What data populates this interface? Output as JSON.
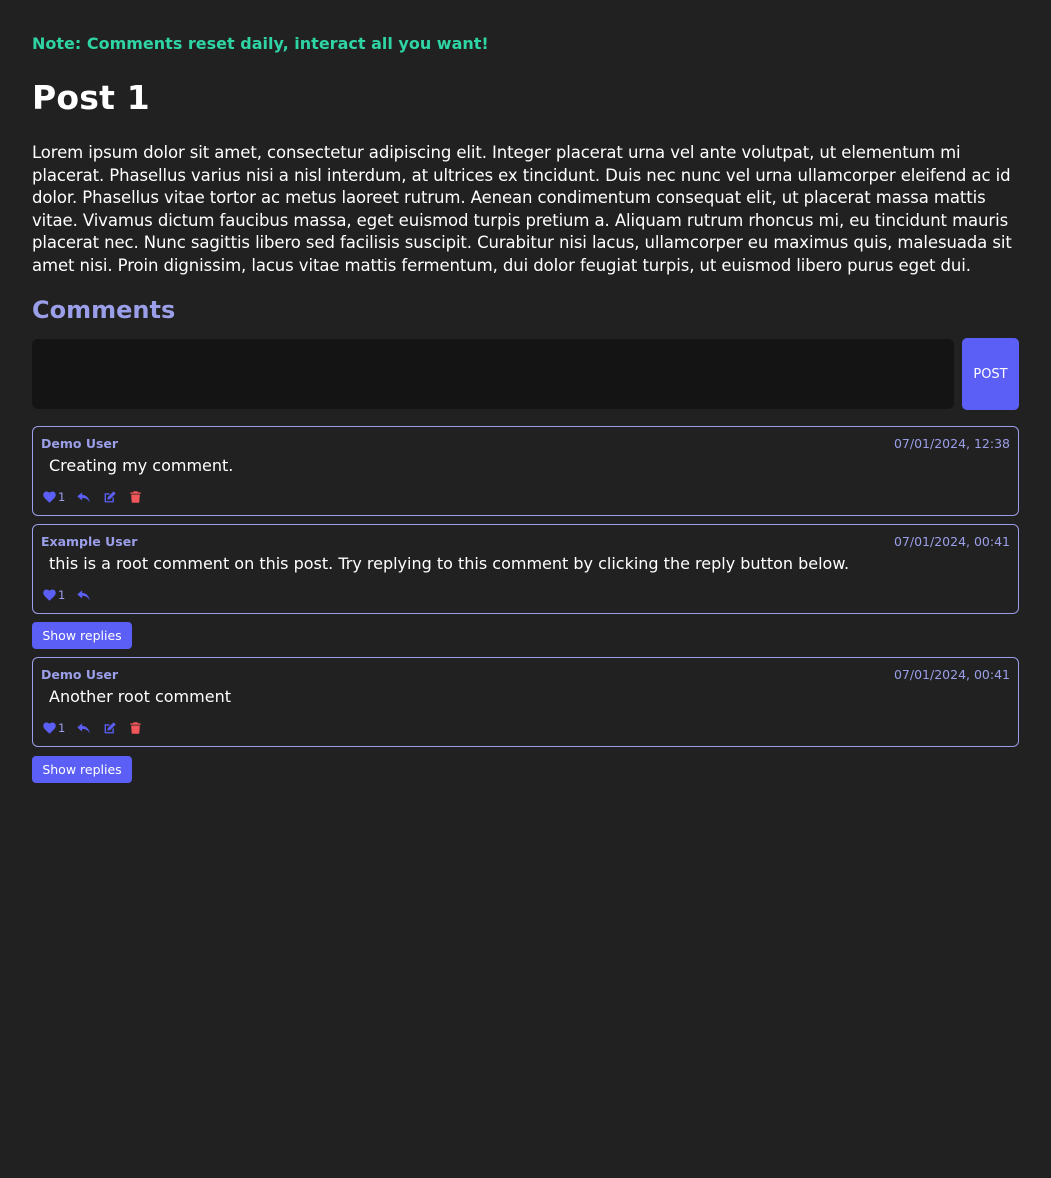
{
  "note": "Note: Comments reset daily, interact all you want!",
  "post": {
    "title": "Post 1",
    "body": "Lorem ipsum dolor sit amet, consectetur adipiscing elit. Integer placerat urna vel ante volutpat, ut elementum mi placerat. Phasellus varius nisi a nisl interdum, at ultrices ex tincidunt. Duis nec nunc vel urna ullamcorper eleifend ac id dolor. Phasellus vitae tortor ac metus laoreet rutrum. Aenean condimentum consequat elit, ut placerat massa mattis vitae. Vivamus dictum faucibus massa, eget euismod turpis pretium a. Aliquam rutrum rhoncus mi, eu tincidunt mauris placerat nec. Nunc sagittis libero sed facilisis suscipit. Curabitur nisi lacus, ullamcorper eu maximus quis, malesuada sit amet nisi. Proin dignissim, lacus vitae mattis fermentum, dui dolor feugiat turpis, ut euismod libero purus eget dui."
  },
  "comments_section": {
    "heading": "Comments",
    "input_value": "",
    "post_button_label": "POST"
  },
  "comments": [
    {
      "author": "Demo User",
      "date": "07/01/2024, 12:38",
      "text": "Creating my comment.",
      "likes": "1",
      "can_edit": true,
      "show_replies_label": null
    },
    {
      "author": "Example User",
      "date": "07/01/2024, 00:41",
      "text": "this is a root comment on this post. Try replying to this comment by clicking the reply button below.",
      "likes": "1",
      "can_edit": false,
      "show_replies_label": "Show replies"
    },
    {
      "author": "Demo User",
      "date": "07/01/2024, 00:41",
      "text": "Another root comment",
      "likes": "1",
      "can_edit": true,
      "show_replies_label": "Show replies"
    }
  ],
  "colors": {
    "background": "#212121",
    "note": "#2fd4a4",
    "accent": "#9b9ee8",
    "button": "#5b5ff5",
    "input_bg": "#141414",
    "delete": "#f0565a"
  },
  "icons": {
    "like": "heart-icon",
    "reply": "reply-icon",
    "edit": "edit-icon",
    "delete": "trash-icon"
  }
}
